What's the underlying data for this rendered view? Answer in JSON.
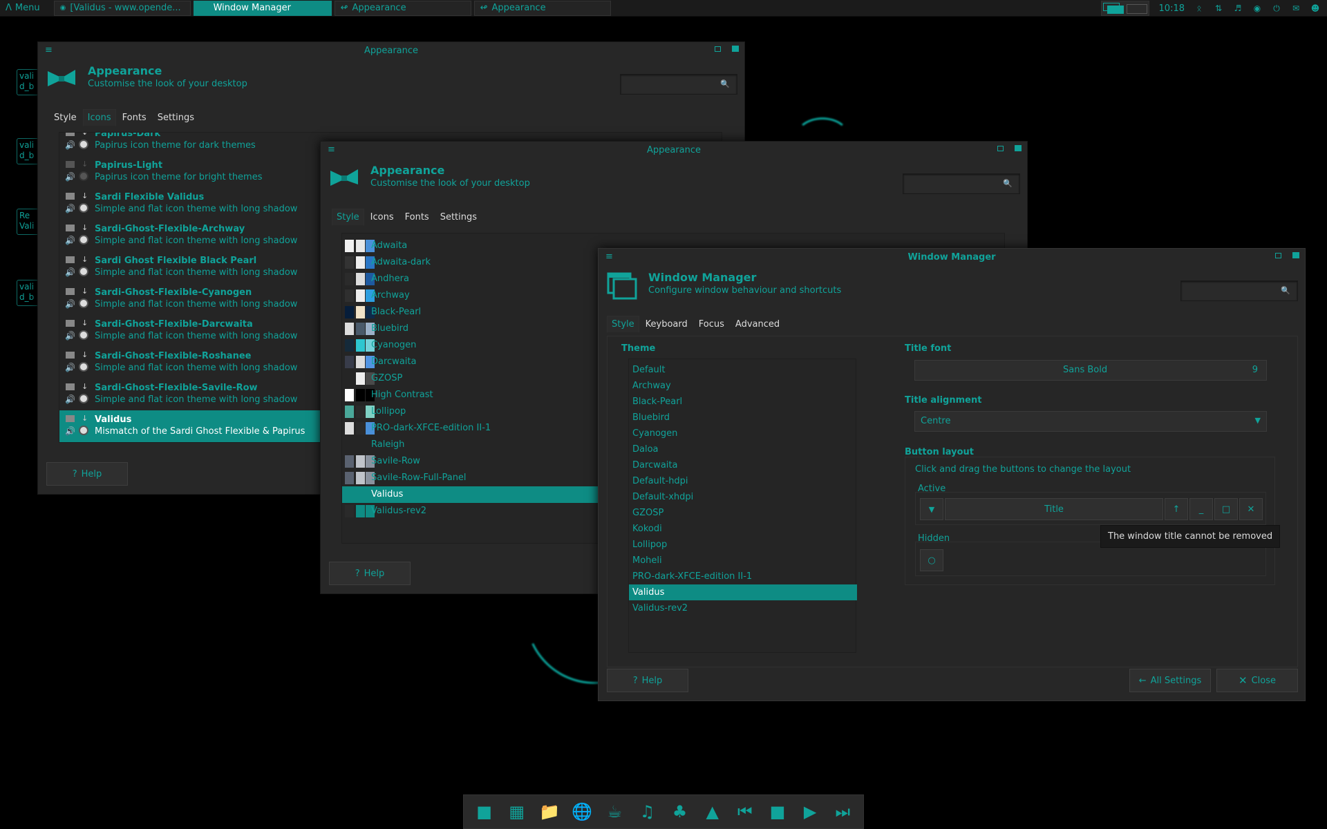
{
  "top_panel": {
    "menu_label": "Menu",
    "tasks": [
      {
        "label": "[Validus - www.opende...",
        "active": false
      },
      {
        "label": "Window Manager",
        "active": true
      },
      {
        "label": "Appearance",
        "active": false
      },
      {
        "label": "Appearance",
        "active": false
      }
    ],
    "clock": "10:18"
  },
  "desktop_icons": [
    "vali d_b",
    "vali d_b",
    "Re Vali",
    "vali d_b"
  ],
  "appearance_back": {
    "title": "Appearance",
    "header_title": "Appearance",
    "header_subtitle": "Customise the look of your desktop",
    "tabs": [
      "Style",
      "Icons",
      "Fonts",
      "Settings"
    ],
    "selected_tab": "Icons",
    "icon_themes": [
      {
        "name": "Papirus-Dark",
        "desc": "Papirus icon theme for dark themes"
      },
      {
        "name": "Papirus-Light",
        "desc": "Papirus icon theme for bright themes"
      },
      {
        "name": "Sardi Flexible Validus",
        "desc": "Simple and flat icon theme with long shadow"
      },
      {
        "name": "Sardi-Ghost-Flexible-Archway",
        "desc": "Simple and flat icon theme with long shadow"
      },
      {
        "name": "Sardi Ghost Flexible Black Pearl",
        "desc": "Simple and flat icon theme with long shadow"
      },
      {
        "name": "Sardi-Ghost-Flexible-Cyanogen",
        "desc": "Simple and flat icon theme with long shadow"
      },
      {
        "name": "Sardi-Ghost-Flexible-Darcwaita",
        "desc": "Simple and flat icon theme with long shadow"
      },
      {
        "name": "Sardi-Ghost-Flexible-Roshanee",
        "desc": "Simple and flat icon theme with long shadow"
      },
      {
        "name": "Sardi-Ghost-Flexible-Savile-Row",
        "desc": "Simple and flat icon theme with long shadow"
      },
      {
        "name": "Validus",
        "desc": "Mismatch of the Sardi Ghost Flexible & Papirus"
      }
    ],
    "selected_icon_theme": "Validus",
    "help_label": "Help"
  },
  "appearance_mid": {
    "title": "Appearance",
    "header_title": "Appearance",
    "header_subtitle": "Customise the look of your desktop",
    "tabs": [
      "Style",
      "Icons",
      "Fonts",
      "Settings"
    ],
    "selected_tab": "Style",
    "styles": [
      {
        "name": "Adwaita",
        "colors": [
          "#f0f0f0",
          "#e8e8e8",
          "#4a90d9"
        ]
      },
      {
        "name": "Adwaita-dark",
        "colors": [
          "#333",
          "#eee",
          "#2a76c6"
        ]
      },
      {
        "name": "Andhera",
        "colors": [
          "#2b2b2b",
          "#ddd",
          "#1e5aa0"
        ]
      },
      {
        "name": "Archway",
        "colors": [
          "#2f2f2f",
          "#eee",
          "#2d9ee0"
        ]
      },
      {
        "name": "Black-Pearl",
        "colors": [
          "#061d3a",
          "#f0e2c8",
          "#0e2a4a"
        ]
      },
      {
        "name": "Bluebird",
        "colors": [
          "#ddd",
          "#4a5a6a",
          "#9bb0c8"
        ]
      },
      {
        "name": "Cyanogen",
        "colors": [
          "#152a3a",
          "#2ec6d0",
          "#74d2da"
        ]
      },
      {
        "name": "Darcwaita",
        "colors": [
          "#383c4a",
          "#ddd",
          "#5294e2"
        ]
      },
      {
        "name": "GZOSP",
        "colors": [
          "#252525",
          "#eee",
          "#4a4a4a"
        ]
      },
      {
        "name": "High Contrast",
        "colors": [
          "#fff",
          "#000",
          "#000"
        ]
      },
      {
        "name": "Lollipop",
        "colors": [
          "#4aa89a",
          "#2a2a2a",
          "#7fd0c4"
        ]
      },
      {
        "name": "PRO-dark-XFCE-edition II-1",
        "colors": [
          "#ddd",
          "#2a2a2a",
          "#4a90d9"
        ]
      },
      {
        "name": "Raleigh",
        "colors": [
          "",
          "",
          ""
        ]
      },
      {
        "name": "Savile-Row",
        "colors": [
          "#5a6270",
          "#c0c4ca",
          "#8a929e"
        ]
      },
      {
        "name": "Savile-Row-Full-Panel",
        "colors": [
          "#5a6270",
          "#c0c4ca",
          "#8a929e"
        ]
      },
      {
        "name": "Validus",
        "colors": [
          "#0e8c84",
          "#0e8c84",
          "#0e8c84"
        ]
      },
      {
        "name": "Validus-rev2",
        "colors": [
          "#2a2a2a",
          "#0e8c84",
          "#0e8c84"
        ]
      }
    ],
    "selected_style": "Validus",
    "help_label": "Help"
  },
  "window_manager": {
    "title": "Window Manager",
    "header_title": "Window Manager",
    "header_subtitle": "Configure window behaviour and shortcuts",
    "tabs": [
      "Style",
      "Keyboard",
      "Focus",
      "Advanced"
    ],
    "selected_tab": "Style",
    "theme_label": "Theme",
    "themes": [
      "Default",
      "Archway",
      "Black-Pearl",
      "Bluebird",
      "Cyanogen",
      "Daloa",
      "Darcwaita",
      "Default-hdpi",
      "Default-xhdpi",
      "GZOSP",
      "Kokodi",
      "Lollipop",
      "Moheli",
      "PRO-dark-XFCE-edition II-1",
      "Validus",
      "Validus-rev2"
    ],
    "selected_theme": "Validus",
    "title_font_label": "Title font",
    "title_font_name": "Sans Bold",
    "title_font_size": "9",
    "title_alignment_label": "Title alignment",
    "title_alignment_value": "Centre",
    "button_layout_label": "Button layout",
    "button_layout_hint": "Click and drag the buttons to change the layout",
    "active_label": "Active",
    "active_title_label": "Title",
    "hidden_label": "Hidden",
    "tooltip": "The window title cannot be removed",
    "help_label": "Help",
    "all_settings_label": "All Settings",
    "close_label": "Close"
  },
  "colors": {
    "accent": "#10a39a",
    "selection": "#0e8c84",
    "window_bg": "#272727"
  }
}
